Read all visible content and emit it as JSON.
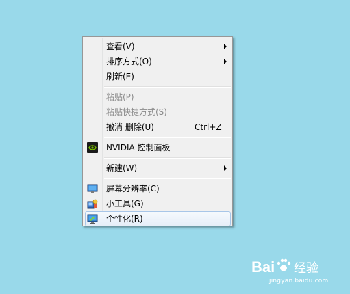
{
  "desktop": {
    "background_color": "#99d9ea"
  },
  "context_menu": {
    "items": [
      {
        "label": "查看(V)",
        "submenu": true,
        "disabled": false,
        "icon": null
      },
      {
        "label": "排序方式(O)",
        "submenu": true,
        "disabled": false,
        "icon": null
      },
      {
        "label": "刷新(E)",
        "submenu": false,
        "disabled": false,
        "icon": null
      },
      {
        "label": "粘贴(P)",
        "submenu": false,
        "disabled": true,
        "icon": null
      },
      {
        "label": "粘贴快捷方式(S)",
        "submenu": false,
        "disabled": true,
        "icon": null
      },
      {
        "label": "撤消 删除(U)",
        "shortcut": "Ctrl+Z",
        "submenu": false,
        "disabled": false,
        "icon": null
      },
      {
        "label": "NVIDIA 控制面板",
        "submenu": false,
        "disabled": false,
        "icon": "nvidia-icon"
      },
      {
        "label": "新建(W)",
        "submenu": true,
        "disabled": false,
        "icon": null
      },
      {
        "label": "屏幕分辨率(C)",
        "submenu": false,
        "disabled": false,
        "icon": "screen-resolution-icon"
      },
      {
        "label": "小工具(G)",
        "submenu": false,
        "disabled": false,
        "icon": "gadgets-icon"
      },
      {
        "label": "个性化(R)",
        "submenu": false,
        "disabled": false,
        "highlighted": true,
        "icon": "personalize-icon"
      }
    ]
  },
  "watermark": {
    "brand": "Bai",
    "brand_suffix": "经验",
    "url": "jingyan.baidu.com"
  }
}
